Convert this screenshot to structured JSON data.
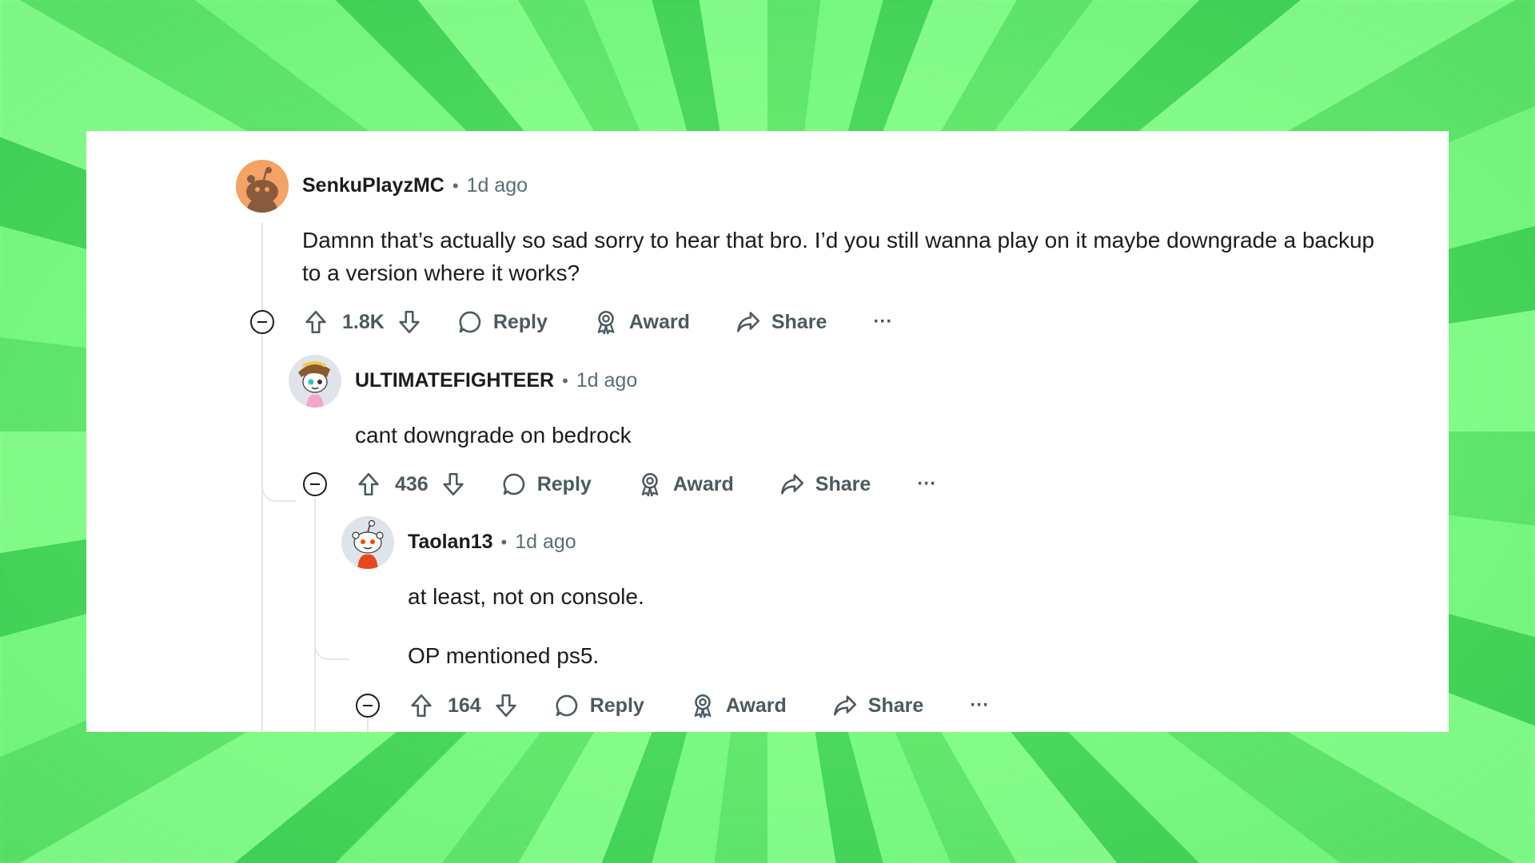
{
  "comments": [
    {
      "username": "SenkuPlayzMC",
      "separator": "•",
      "time": "1d ago",
      "body": [
        "Damnn that’s actually so sad sorry to hear that bro. I’d you still wanna play on it maybe downgrade a backup to a version where it works?"
      ],
      "score": "1.8K",
      "reply_label": "Reply",
      "award_label": "Award",
      "share_label": "Share",
      "more_label": "···",
      "avatar_color": "#f4a265"
    },
    {
      "username": "ULTIMATEFIGHTEER",
      "separator": "•",
      "time": "1d ago",
      "body": [
        "cant downgrade on bedrock"
      ],
      "score": "436",
      "reply_label": "Reply",
      "award_label": "Award",
      "share_label": "Share",
      "more_label": "···",
      "avatar_color": "#dfe4ea"
    },
    {
      "username": "Taolan13",
      "separator": "•",
      "time": "1d ago",
      "body": [
        "at least, not on console.",
        "OP mentioned ps5."
      ],
      "score": "164",
      "reply_label": "Reply",
      "award_label": "Award",
      "share_label": "Share",
      "more_label": "···",
      "avatar_color": "#dfe4ea"
    }
  ],
  "colors": {
    "background": "#6ff57a",
    "card": "#ffffff",
    "text": "#1c1c1c",
    "meta": "#576f76",
    "thread_line": "#e3e6e8"
  }
}
